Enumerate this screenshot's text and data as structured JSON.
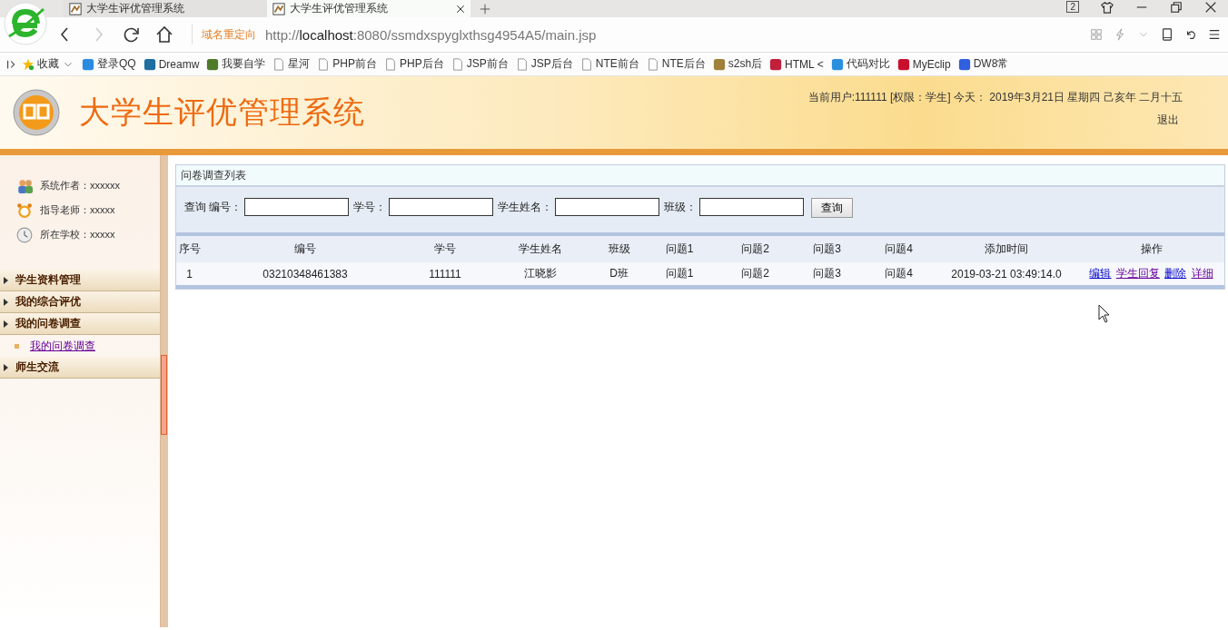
{
  "browser": {
    "tabs": [
      {
        "title": "大学生评优管理系统",
        "selected": false
      },
      {
        "title": "大学生评优管理系统",
        "selected": true
      }
    ],
    "tab_count": "2",
    "redirect_label": "域名重定向",
    "url": {
      "scheme": "http://",
      "host": "localhost",
      "path": ":8080/ssmdxspyglxthsg4954A5/main.jsp"
    },
    "bookmarks": [
      {
        "label": "收藏",
        "kind": "favorites"
      },
      {
        "label": "登录QQ",
        "kind": "site",
        "color": "#2a8be0"
      },
      {
        "label": "Dreamw",
        "kind": "site",
        "color": "#1e6f9f"
      },
      {
        "label": "我要自学",
        "kind": "site",
        "color": "#4f7a2a"
      },
      {
        "label": "星河",
        "kind": "page"
      },
      {
        "label": "PHP前台",
        "kind": "page"
      },
      {
        "label": "PHP后台",
        "kind": "page"
      },
      {
        "label": "JSP前台",
        "kind": "page"
      },
      {
        "label": "JSP后台",
        "kind": "page"
      },
      {
        "label": "NTE前台",
        "kind": "page"
      },
      {
        "label": "NTE后台",
        "kind": "page"
      },
      {
        "label": "s2sh后",
        "kind": "site",
        "color": "#a0803a"
      },
      {
        "label": "HTML <",
        "kind": "site",
        "color": "#c0203a"
      },
      {
        "label": "代码对比",
        "kind": "site",
        "color": "#2b8fe0"
      },
      {
        "label": "MyEclip",
        "kind": "site",
        "color": "#c8102e"
      },
      {
        "label": "DW8常",
        "kind": "site",
        "color": "#3060e0"
      }
    ]
  },
  "header": {
    "title": "大学生评优管理系统",
    "user_info": "当前用户:111111 [权限：学生] 今天： 2019年3月21日 星期四 己亥年 二月十五",
    "logout": "退出"
  },
  "sidebar": {
    "info": [
      {
        "kind": "people",
        "text": "系统作者：xxxxxx"
      },
      {
        "kind": "alarm",
        "text": "指导老师：xxxxx"
      },
      {
        "kind": "clock",
        "text": "所在学校：xxxxx"
      }
    ],
    "menu": [
      {
        "label": "学生资料管理"
      },
      {
        "label": "我的综合评优"
      },
      {
        "label": "我的问卷调查",
        "children": [
          {
            "label": "我的问卷调查",
            "visited": true
          }
        ]
      },
      {
        "label": "师生交流"
      }
    ]
  },
  "panel": {
    "title": "问卷调查列表",
    "search": {
      "label": "查询",
      "fields": [
        {
          "label": "编号："
        },
        {
          "label": "学号："
        },
        {
          "label": "学生姓名："
        },
        {
          "label": "班级："
        }
      ],
      "button": "查询"
    },
    "table": {
      "columns": [
        "序号",
        "编号",
        "学号",
        "学生姓名",
        "班级",
        "问题1",
        "问题2",
        "问题3",
        "问题4",
        "添加时间",
        "操作"
      ],
      "rows": [
        {
          "cells": [
            "1",
            "03210348461383",
            "111111",
            "江晓影",
            "D班",
            "问题1",
            "问题2",
            "问题3",
            "问题4",
            "2019-03-21 03:49:14.0"
          ],
          "actions": [
            {
              "label": "编辑",
              "visited": false
            },
            {
              "label": "学生回复",
              "visited": true
            },
            {
              "label": "删除",
              "visited": false
            },
            {
              "label": "详细",
              "visited": true
            }
          ]
        }
      ]
    }
  }
}
